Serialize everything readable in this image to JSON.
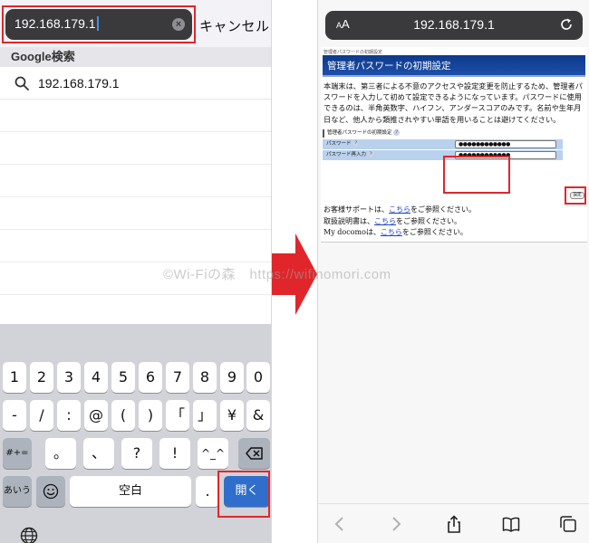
{
  "left_phone": {
    "url_input_value": "192.168.179.1",
    "cancel_label": "キャンセル",
    "section_header": "Google検索",
    "suggestion": "192.168.179.1",
    "keyboard": {
      "row1": [
        "1",
        "2",
        "3",
        "4",
        "5",
        "6",
        "7",
        "8",
        "9",
        "0"
      ],
      "row2": [
        "-",
        "/",
        ":",
        "@",
        "(",
        ")",
        "「",
        "」",
        "¥",
        "&"
      ],
      "row3": [
        "#+=",
        "。",
        "、",
        "?",
        "!",
        "^_^"
      ],
      "row4": [
        "あいう",
        "空白",
        ".",
        "開く"
      ]
    }
  },
  "right_phone": {
    "aa_label": "AA",
    "url": "192.168.179.1",
    "page": {
      "crumb": "管理者パスワードの初期設定",
      "title": "管理者パスワードの初期設定",
      "description": "本端末は、第三者による不意のアクセスや設定変更を防止するため、管理者パスワードを入力して初めて設定できるようになっています。パスワードに使用できるのは、半角英数字、ハイフン、アンダースコアのみです。名前や生年月日など、他人から類推されやすい単語を用いることは避けてください。",
      "form_title": "管理者パスワードの初期設定",
      "fields": [
        {
          "label": "パスワード",
          "value": "●●●●●●●●●●●●"
        },
        {
          "label": "パスワード再入力",
          "value": "●●●●●●●●●●●●"
        }
      ],
      "submit_label": "設定",
      "links": [
        {
          "pre": "お客様サポートは、",
          "link": "こちら",
          "post": "をご参照ください。"
        },
        {
          "pre": "取扱説明書は、",
          "link": "こちら",
          "post": "をご参照ください。"
        },
        {
          "pre": "My docomoは、",
          "link": "こちら",
          "post": "をご参照ください。"
        }
      ]
    }
  },
  "watermark": "©Wi-Fiの森　https://wifinomori.com",
  "colors": {
    "highlight_red": "#e0262b",
    "arrow_red": "#e0262b",
    "key_blue": "#2f6ecb",
    "title_navy": "#0d3a8c"
  }
}
